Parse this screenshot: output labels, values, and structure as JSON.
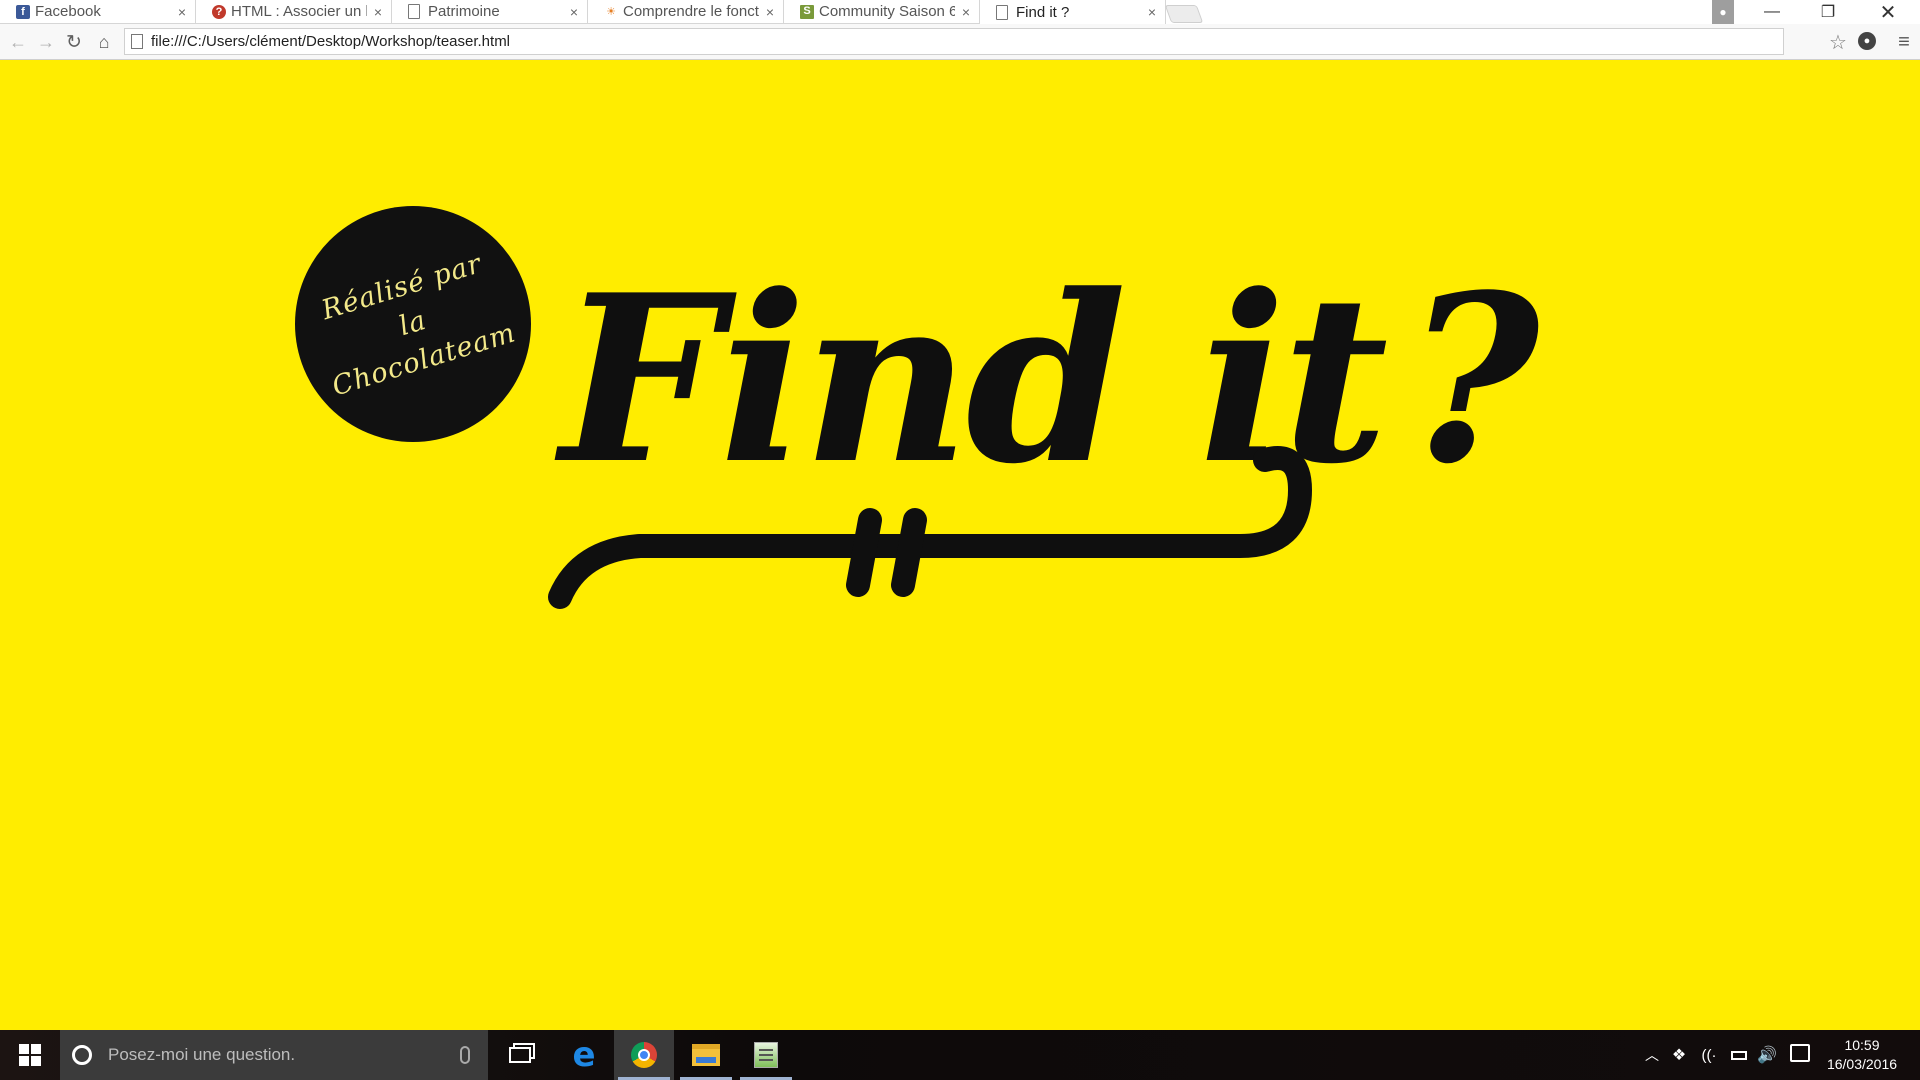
{
  "browser": {
    "tabs": [
      {
        "label": "Facebook",
        "favicon": "facebook-icon"
      },
      {
        "label": "HTML : Associer un li",
        "favicon": "question-icon"
      },
      {
        "label": "Patrimoine",
        "favicon": "document-icon"
      },
      {
        "label": "Comprendre le fonct",
        "favicon": "sun-icon"
      },
      {
        "label": "Community Saison 6",
        "favicon": "serie-icon"
      },
      {
        "label": "Find it ?",
        "favicon": "document-icon",
        "active": true
      }
    ],
    "tab_close_glyph": "×",
    "address": "file:///C:/Users/clément/Desktop/Workshop/teaser.html"
  },
  "page": {
    "background_color": "#ffed00",
    "badge_text": "Réalisé par la Chocolateam",
    "logo_text": "Find it",
    "logo_punct": "?"
  },
  "taskbar": {
    "search_placeholder": "Posez-moi une question.",
    "apps": [
      "task-view-icon",
      "edge-icon",
      "chrome-icon",
      "file-explorer-icon",
      "notepad-icon"
    ],
    "clock_time": "10:59",
    "clock_date": "16/03/2016"
  }
}
